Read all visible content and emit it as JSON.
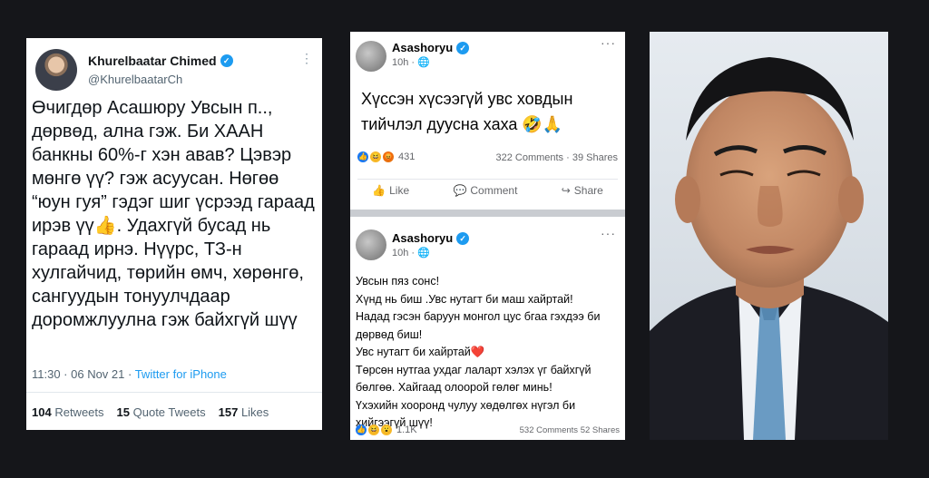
{
  "twitter": {
    "display_name": "Khurelbaatar Chimed",
    "handle": "@KhurelbaatarCh",
    "more_icon": "⋮",
    "body": "Өчигдөр Асашюру Увсын п.., дөрвөд, ална гэж. Би ХААН банкны 60%-г хэн авав? Цэвэр мөнгө үү? гэж асуусан. Нөгөө “юун гуя” гэдэг шиг үсрээд гараад ирэв үү👍. Удахгүй бусад нь гараад ирнэ. Нүүрс, ТЗ-н хулгайчид, төрийн өмч, хөрөнгө, сангуудын тонуулчдаар доромжлуулна гэж байхгүй шүү",
    "time": "11:30 · 06 Nov 21 · ",
    "source": "Twitter for iPhone",
    "retweets_count": "104",
    "retweets_label": "Retweets",
    "quotes_count": "15",
    "quotes_label": "Quote Tweets",
    "likes_count": "157",
    "likes_label": "Likes"
  },
  "facebook": {
    "post1": {
      "author": "Asashoryu",
      "time": "10h · ",
      "text": "Хүссэн хүсээгүй увс ховдын тийчлэл дууснa хаха 🤣🙏",
      "reactions_count": "431",
      "comments": "322 Comments",
      "shares": "39 Shares",
      "like_label": "Like",
      "comment_label": "Comment",
      "share_label": "Share"
    },
    "post2": {
      "author": "Asashoryu",
      "time": "10h · ",
      "text": "Увсын пяз сонс!\nХүнд нь биш .Увс нутагт би маш хайртай!\nНадад гэсэн баруун монгол цус бгаа гэхдээ би дөрвөд биш!\nУвс нутагт би хайртай❤️\nТөрсөн нутгаа ухдаг лаларт хэлэх үг байхгүй бөлгөө. Хайгаад олоорой гөлөг минь!\nҮхэхийн хооронд чулуу хөдөлгөх нүгэл би хийгээгүй шүү!",
      "reactions_count": "1.1K",
      "comments": "532 Comments",
      "shares": "52 Shares"
    },
    "more_icon": "···"
  },
  "photo": {
    "description_icon": "portrait-photo"
  }
}
